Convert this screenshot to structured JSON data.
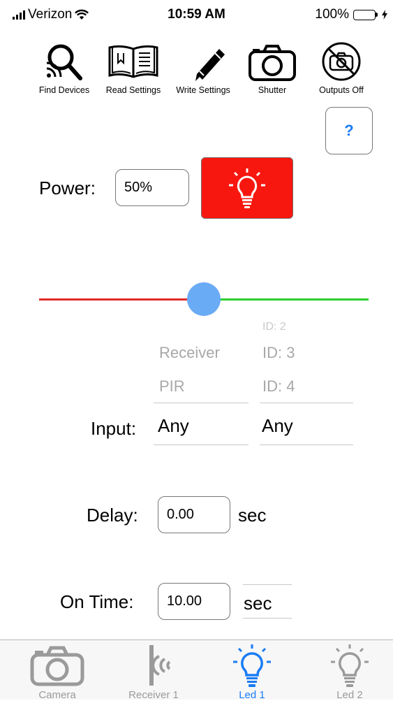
{
  "status_bar": {
    "carrier": "Verizon",
    "time": "10:59 AM",
    "battery": "100%"
  },
  "toolbar": {
    "find_devices": "Find Devices",
    "read_settings": "Read Settings",
    "write_settings": "Write Settings",
    "shutter": "Shutter",
    "outputs_off": "Outputs Off"
  },
  "help_label": "?",
  "power": {
    "label": "Power:",
    "value": "50%",
    "button_color": "#f7170f"
  },
  "slider": {
    "value": 0.5,
    "left_color": "#e12a2a",
    "right_color": "#2ed02e",
    "thumb_color": "#6aabf5"
  },
  "input": {
    "label": "Input:",
    "source_picker": {
      "above": [
        "Receiver",
        "PIR"
      ],
      "selected": "Any"
    },
    "id_picker": {
      "above": [
        "ID: 2",
        "ID: 3",
        "ID: 4"
      ],
      "selected": "Any"
    }
  },
  "delay": {
    "label": "Delay:",
    "value": "0.00",
    "unit": "sec"
  },
  "on_time": {
    "label": "On Time:",
    "value": "10.00",
    "unit": "sec"
  },
  "tabs": [
    {
      "label": "Camera",
      "icon": "camera-icon",
      "active": false
    },
    {
      "label": "Receiver 1",
      "icon": "receiver-icon",
      "active": false
    },
    {
      "label": "Led 1",
      "icon": "lightbulb-icon",
      "active": true
    },
    {
      "label": "Led 2",
      "icon": "lightbulb-icon",
      "active": false
    }
  ],
  "accent_color": "#1a7cf5"
}
